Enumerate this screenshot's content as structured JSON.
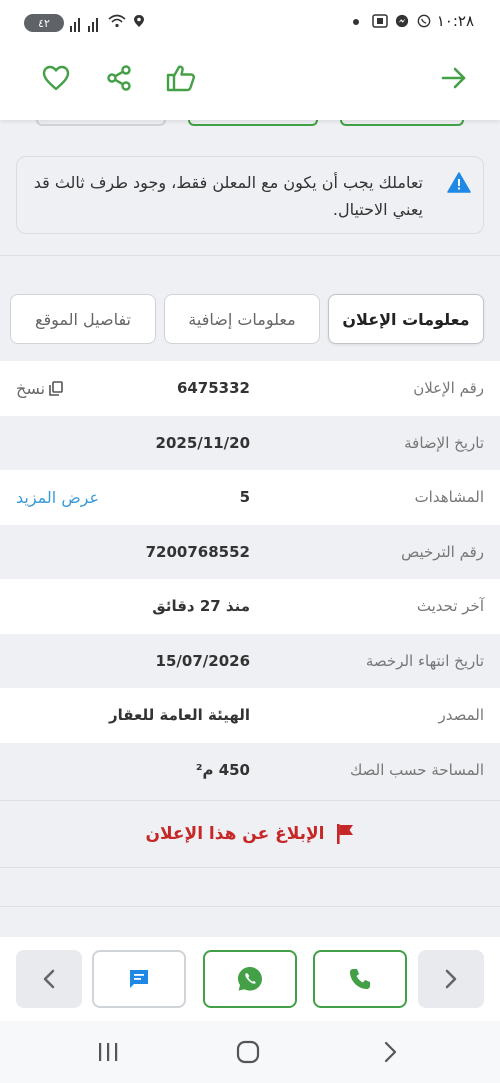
{
  "status_bar": {
    "time": "١٠:٢٨",
    "battery": "٤٢",
    "icons": [
      "battery-icon",
      "signal-icon",
      "wifi-icon",
      "location-icon",
      "dot-icon",
      "screenshot-icon",
      "messenger-icon",
      "whatsapp-icon"
    ]
  },
  "topbar": {
    "icons": [
      "heart-icon",
      "share-icon",
      "thumbs-up-icon",
      "arrow-right-icon"
    ],
    "accent": "#43a047"
  },
  "warning": {
    "text": "تعاملك يجب أن يكون مع المعلن فقط، وجود طرف ثالث قد يعني الاحتيال.",
    "icon": "warning-icon",
    "icon_color": "#1e88e5"
  },
  "tabs": [
    {
      "label": "معلومات الإعلان",
      "active": true
    },
    {
      "label": "معلومات إضافية",
      "active": false
    },
    {
      "label": "تفاصيل الموقع",
      "active": false
    }
  ],
  "details": [
    {
      "label": "رقم الإعلان",
      "value": "6475332",
      "action": "نسخ",
      "action_icon": "copy-icon"
    },
    {
      "label": "تاريخ الإضافة",
      "value": "2025/11/20",
      "action": ""
    },
    {
      "label": "المشاهدات",
      "value": "5",
      "action": "عرض المزيد",
      "action_color": "#3a9ad9"
    },
    {
      "label": "رقم الترخيص",
      "value": "7200768552",
      "action": ""
    },
    {
      "label": "آخر تحديث",
      "value": "منذ 27 دقائق",
      "action": ""
    },
    {
      "label": "تاريخ انتهاء الرخصة",
      "value": "15/07/2026",
      "action": ""
    },
    {
      "label": "المصدر",
      "value": "الهيئة العامة للعقار",
      "action": ""
    },
    {
      "label": "المساحة حسب الصك",
      "value": "450 م²",
      "action": ""
    }
  ],
  "report": {
    "label": "الإبلاغ عن هذا الإعلان",
    "icon": "flag-icon",
    "color": "#c62828"
  },
  "bottom_bar": {
    "buttons": [
      "chevron-left-icon",
      "chat-icon",
      "whatsapp-icon",
      "phone-icon",
      "chevron-right-icon"
    ],
    "chat_color": "#1e88e5",
    "green": "#43a047"
  },
  "system_nav": [
    "recents-icon",
    "home-icon",
    "back-icon"
  ]
}
